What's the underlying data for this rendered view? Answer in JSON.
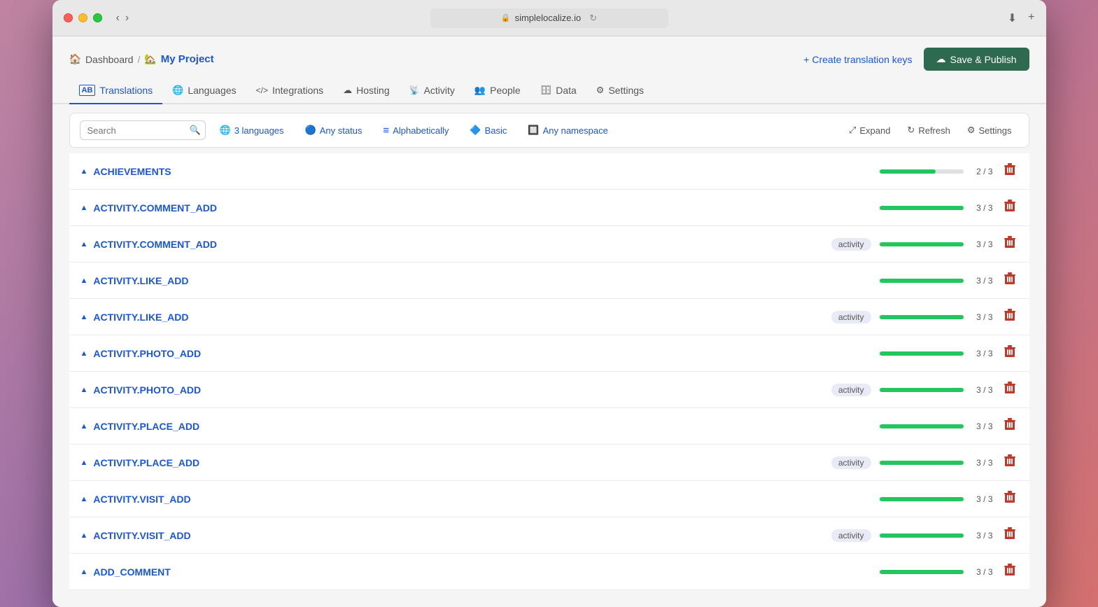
{
  "window": {
    "url": "simplelocalize.io",
    "title": "My Project - Translations"
  },
  "breadcrumb": {
    "home_label": "Dashboard",
    "separator": "/",
    "project_emoji": "🏡",
    "project_name": "My Project"
  },
  "actions": {
    "create_keys_label": "+ Create translation keys",
    "save_publish_label": "Save & Publish"
  },
  "nav_tabs": [
    {
      "id": "translations",
      "label": "Translations",
      "icon": "AB",
      "active": true
    },
    {
      "id": "languages",
      "label": "Languages",
      "icon": "🌐",
      "active": false
    },
    {
      "id": "integrations",
      "label": "Integrations",
      "icon": "</>",
      "active": false
    },
    {
      "id": "hosting",
      "label": "Hosting",
      "icon": "☁",
      "active": false
    },
    {
      "id": "activity",
      "label": "Activity",
      "icon": "📡",
      "active": false
    },
    {
      "id": "people",
      "label": "People",
      "icon": "👥",
      "active": false
    },
    {
      "id": "data",
      "label": "Data",
      "icon": "🗄",
      "active": false
    },
    {
      "id": "settings",
      "label": "Settings",
      "icon": "⚙",
      "active": false
    }
  ],
  "toolbar": {
    "search_placeholder": "Search",
    "filters": [
      {
        "id": "languages",
        "label": "3 languages",
        "icon": "🌐"
      },
      {
        "id": "status",
        "label": "Any status",
        "icon": "🔵"
      },
      {
        "id": "sort",
        "label": "Alphabetically",
        "icon": "≡"
      },
      {
        "id": "tier",
        "label": "Basic",
        "icon": "🔷"
      },
      {
        "id": "namespace",
        "label": "Any namespace",
        "icon": "🔲"
      }
    ],
    "actions": [
      {
        "id": "expand",
        "label": "Expand",
        "icon": "⤢"
      },
      {
        "id": "refresh",
        "label": "Refresh",
        "icon": "↻"
      },
      {
        "id": "settings",
        "label": "Settings",
        "icon": "⚙"
      }
    ]
  },
  "items": [
    {
      "key": "ACHIEVEMENTS",
      "namespace": null,
      "progress": 67,
      "count": "2 / 3",
      "full": false
    },
    {
      "key": "ACTIVITY.COMMENT_ADD",
      "namespace": null,
      "progress": 100,
      "count": "3 / 3",
      "full": true
    },
    {
      "key": "ACTIVITY.COMMENT_ADD",
      "namespace": "activity",
      "progress": 100,
      "count": "3 / 3",
      "full": true
    },
    {
      "key": "ACTIVITY.LIKE_ADD",
      "namespace": null,
      "progress": 100,
      "count": "3 / 3",
      "full": true
    },
    {
      "key": "ACTIVITY.LIKE_ADD",
      "namespace": "activity",
      "progress": 100,
      "count": "3 / 3",
      "full": true
    },
    {
      "key": "ACTIVITY.PHOTO_ADD",
      "namespace": null,
      "progress": 100,
      "count": "3 / 3",
      "full": true
    },
    {
      "key": "ACTIVITY.PHOTO_ADD",
      "namespace": "activity",
      "progress": 100,
      "count": "3 / 3",
      "full": true
    },
    {
      "key": "ACTIVITY.PLACE_ADD",
      "namespace": null,
      "progress": 100,
      "count": "3 / 3",
      "full": true
    },
    {
      "key": "ACTIVITY.PLACE_ADD",
      "namespace": "activity",
      "progress": 100,
      "count": "3 / 3",
      "full": true
    },
    {
      "key": "ACTIVITY.VISIT_ADD",
      "namespace": null,
      "progress": 100,
      "count": "3 / 3",
      "full": true
    },
    {
      "key": "ACTIVITY.VISIT_ADD",
      "namespace": "activity",
      "progress": 100,
      "count": "3 / 3",
      "full": true
    },
    {
      "key": "ADD_COMMENT",
      "namespace": null,
      "progress": 100,
      "count": "3 / 3",
      "full": true
    }
  ],
  "colors": {
    "accent": "#1a56db",
    "green": "#22c55e",
    "red": "#c0392b",
    "badge_bg": "#e8eaf6"
  }
}
